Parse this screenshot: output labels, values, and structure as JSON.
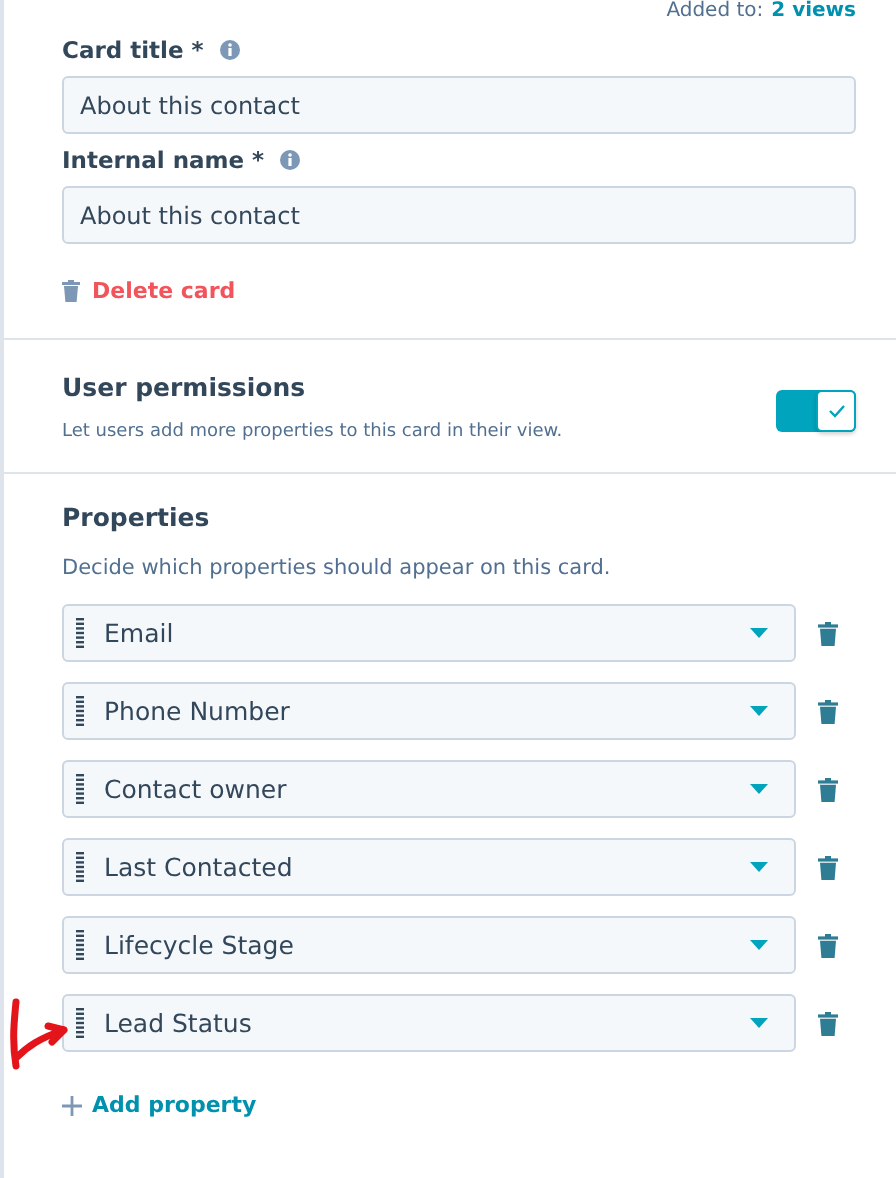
{
  "added_to": {
    "label": "Added to:",
    "link": "2 views"
  },
  "fields": [
    {
      "label": "Card title *",
      "value": "About this contact"
    },
    {
      "label": "Internal name *",
      "value": "About this contact"
    }
  ],
  "delete_card": "Delete card",
  "permissions": {
    "title": "User permissions",
    "description": "Let users add more properties to this card in their view.",
    "on": true
  },
  "properties": {
    "title": "Properties",
    "description": "Decide which properties should appear on this card.",
    "items": [
      {
        "label": "Email"
      },
      {
        "label": "Phone Number"
      },
      {
        "label": "Contact owner"
      },
      {
        "label": "Last Contacted"
      },
      {
        "label": "Lifecycle Stage"
      },
      {
        "label": "Lead Status",
        "annotated": true
      }
    ],
    "add": "Add property"
  }
}
